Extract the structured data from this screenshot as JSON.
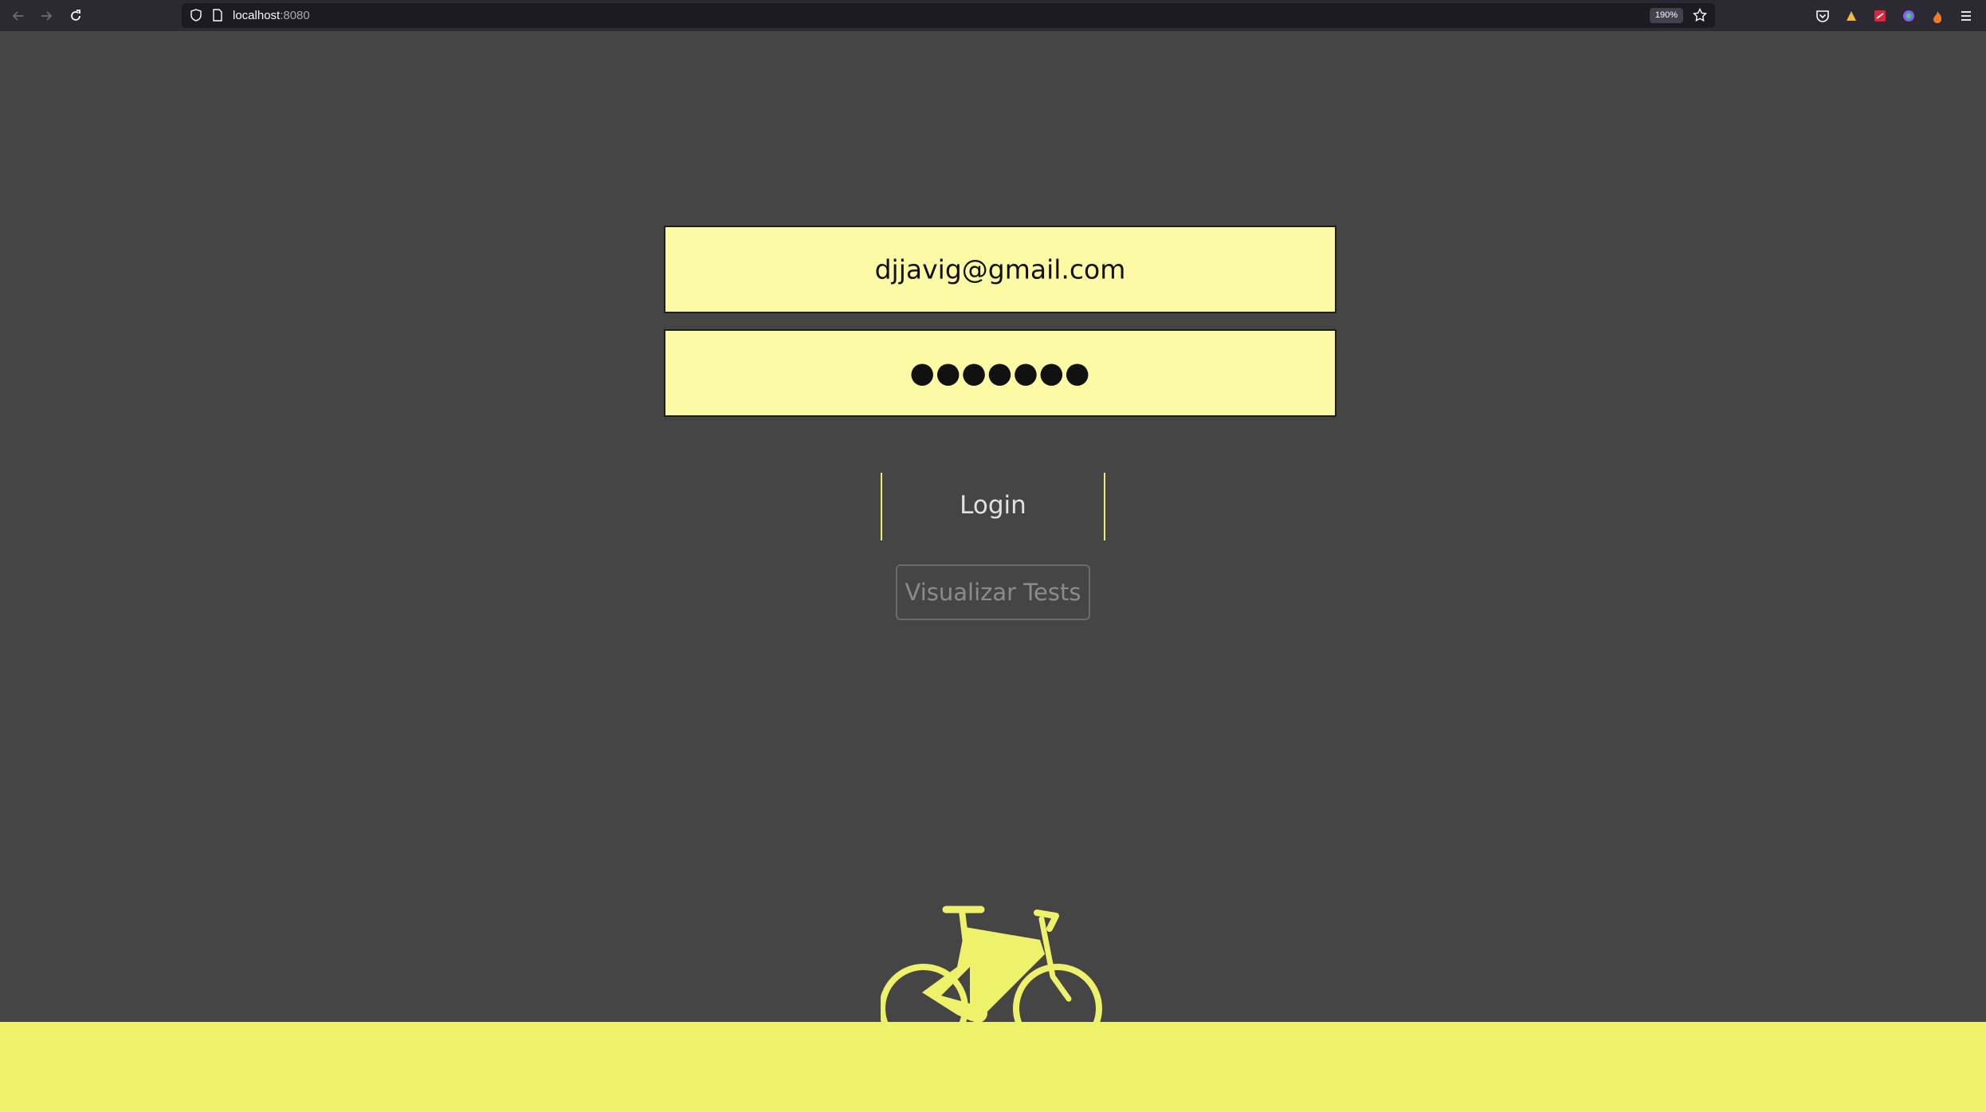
{
  "browser": {
    "url_host": "localhost",
    "url_port": ":8080",
    "zoom": "190%",
    "icons": [
      "back-arrow-icon",
      "forward-arrow-icon",
      "reload-icon",
      "shield-icon",
      "page-icon",
      "star-icon",
      "pocket-icon",
      "extension-icon",
      "menu-icon"
    ]
  },
  "login_form": {
    "email_value": "djjavig@gmail.com",
    "password_value": "●●●●●●●",
    "login_label": "Login",
    "tests_label": "Visualizar Tests"
  },
  "colors": {
    "background": "#454545",
    "field": "#fdfaa6",
    "accent": "#eef26b",
    "bike": "#eef26b"
  }
}
